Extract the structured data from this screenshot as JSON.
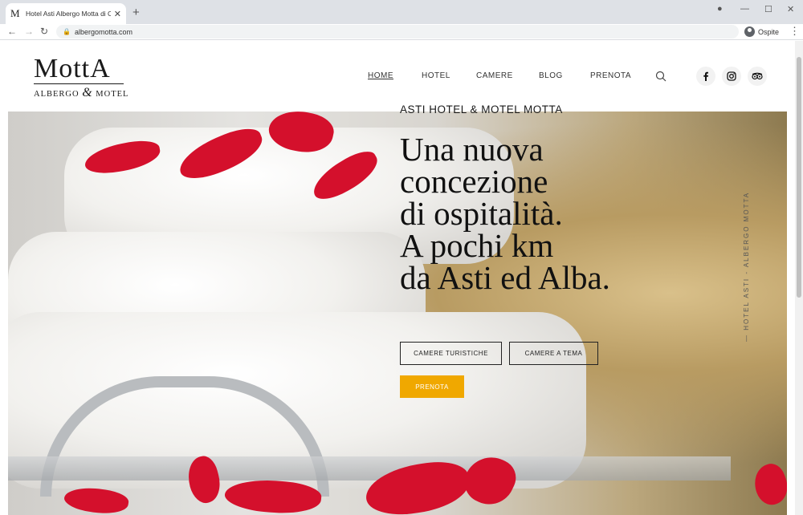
{
  "browser": {
    "tab_title": "Hotel Asti Albergo Motta di Cos",
    "tab_favicon": "M",
    "new_tab": "+",
    "url": "albergomotta.com",
    "profile_label": "Ospite"
  },
  "site": {
    "logo": {
      "main": "MottA",
      "sub_left": "ALBERGO",
      "sub_amp": "&",
      "sub_right": "MOTEL"
    },
    "nav": [
      {
        "label": "HOME",
        "active": true
      },
      {
        "label": "HOTEL"
      },
      {
        "label": "CAMERE"
      },
      {
        "label": "BLOG"
      },
      {
        "label": "PRENOTA"
      }
    ],
    "social": [
      "facebook-icon",
      "instagram-icon",
      "tripadvisor-icon"
    ]
  },
  "hero": {
    "eyebrow": "ASTI HOTEL & MOTEL MOTTA",
    "headline": [
      "Una nuova",
      "concezione",
      "di ospitalità.",
      "A pochi km",
      "da Asti ed Alba."
    ],
    "btn_touristic": "CAMERE TURISTICHE",
    "btn_theme": "CAMERE A TEMA",
    "btn_book": "PRENOTA",
    "vertical_label": "— HOTEL ASTI - ALBERGO MOTTA",
    "accent_color": "#f0a800"
  }
}
